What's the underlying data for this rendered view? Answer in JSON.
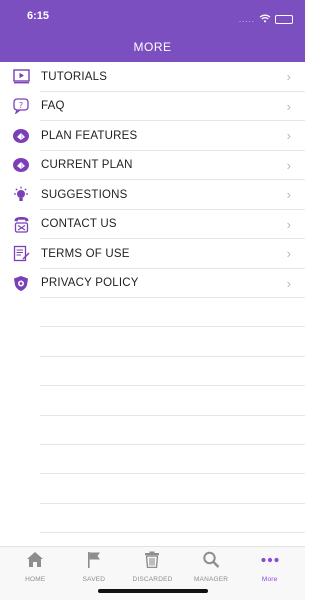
{
  "status": {
    "time": "6:15",
    "signal": "....."
  },
  "header": {
    "title": "MORE"
  },
  "colors": {
    "accent": "#7c4fc1",
    "icon": "#7b3fb8"
  },
  "menu": [
    {
      "label": "TUTORIALS",
      "icon": "play-video-icon"
    },
    {
      "label": "FAQ",
      "icon": "question-bubble-icon"
    },
    {
      "label": "PLAN FEATURES",
      "icon": "plan-badge-icon"
    },
    {
      "label": "CURRENT PLAN",
      "icon": "plan-badge-icon"
    },
    {
      "label": "SUGGESTIONS",
      "icon": "lightbulb-icon"
    },
    {
      "label": "CONTACT US",
      "icon": "phone-icon"
    },
    {
      "label": "TERMS OF USE",
      "icon": "document-edit-icon"
    },
    {
      "label": "PRIVACY POLICY",
      "icon": "shield-icon"
    }
  ],
  "tabs": [
    {
      "label": "HOME",
      "icon": "home-icon",
      "active": false
    },
    {
      "label": "SAVED",
      "icon": "flag-icon",
      "active": false
    },
    {
      "label": "DISCARDED",
      "icon": "trash-icon",
      "active": false
    },
    {
      "label": "MANAGER",
      "icon": "search-icon",
      "active": false
    },
    {
      "label": "More",
      "icon": "more-dots-icon",
      "active": true
    }
  ]
}
